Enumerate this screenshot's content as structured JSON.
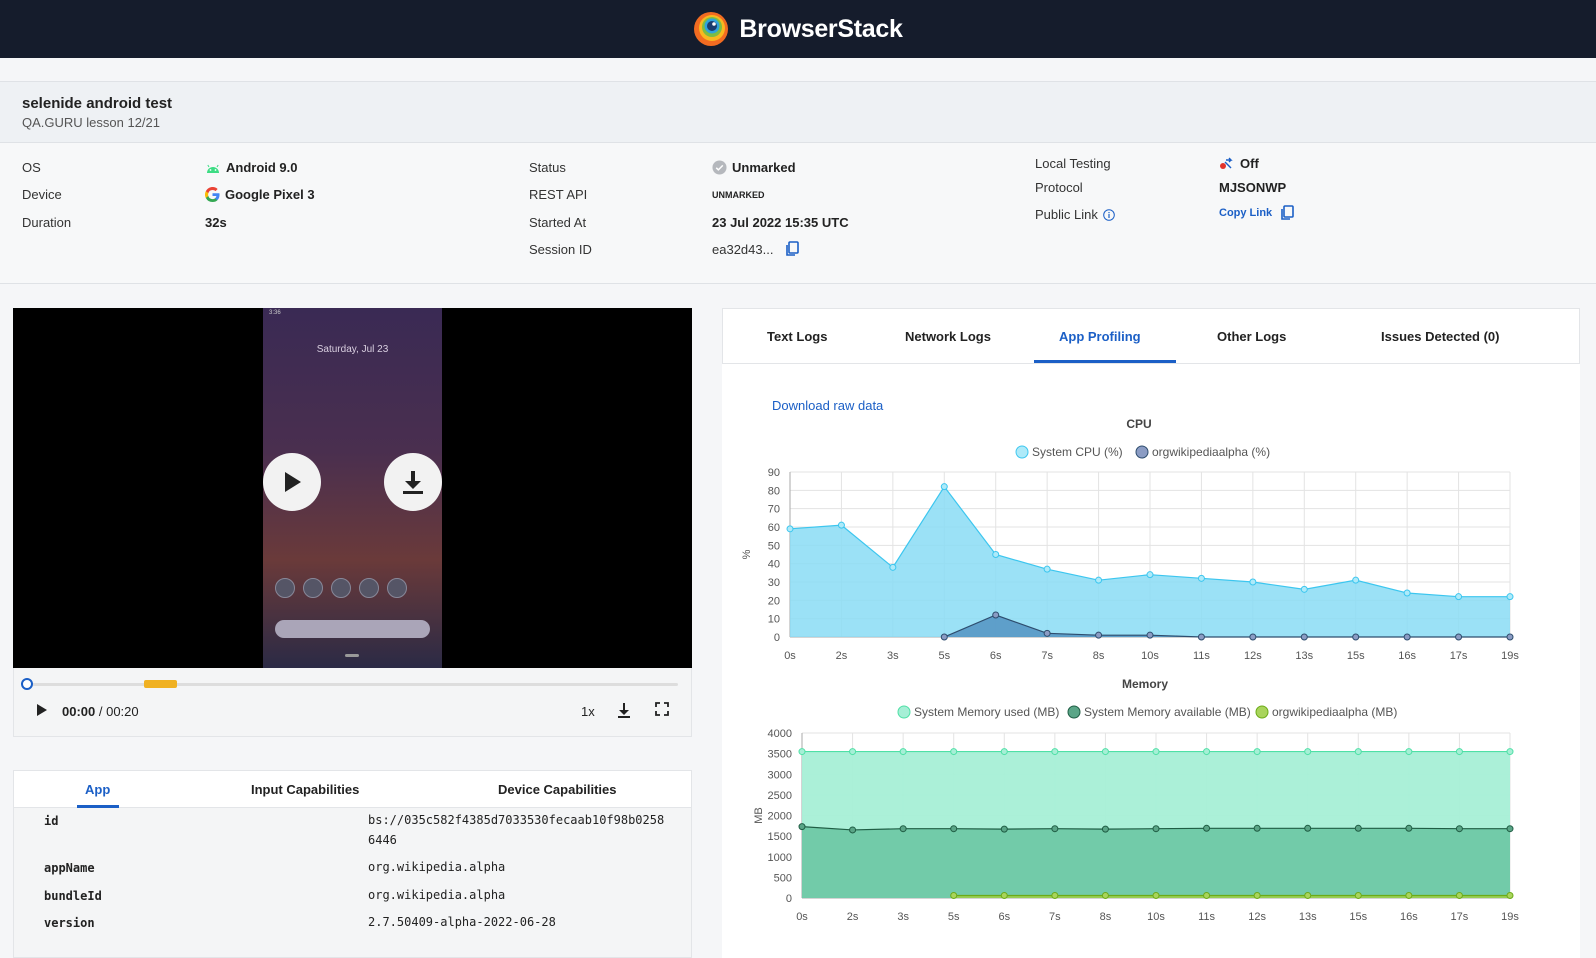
{
  "brand": {
    "name": "BrowserStack"
  },
  "build": {
    "title": "selenide android test",
    "subtitle": "QA.GURU lesson 12/21"
  },
  "details": {
    "os_label": "OS",
    "os_value": "Android 9.0",
    "device_label": "Device",
    "device_value": "Google Pixel 3",
    "duration_label": "Duration",
    "duration_value": "32s",
    "status_label": "Status",
    "status_value": "Unmarked",
    "rest_label": "REST API",
    "rest_value": "UNMARKED",
    "started_label": "Started At",
    "started_value": "23 Jul 2022 15:35 UTC",
    "session_label": "Session ID",
    "session_value": "ea32d43...",
    "local_label": "Local Testing",
    "local_value": "Off",
    "protocol_label": "Protocol",
    "protocol_value": "MJSONWP",
    "public_label": "Public Link",
    "public_value": "Copy Link"
  },
  "video": {
    "phone_date": "Saturday, Jul 23",
    "phone_time": "3:36",
    "current": "00:00",
    "total": "/ 00:20",
    "speed": "1x",
    "progress": 0,
    "buffered_from": 0.18,
    "buffered_to": 0.23
  },
  "left_tabs": [
    {
      "label": "App",
      "active": true
    },
    {
      "label": "Input Capabilities",
      "active": false
    },
    {
      "label": "Device Capabilities",
      "active": false
    }
  ],
  "caps": [
    {
      "key": "id",
      "value": "bs://035c582f4385d7033530fecaab10f98b02586446"
    },
    {
      "key": "appName",
      "value": "org.wikipedia.alpha"
    },
    {
      "key": "bundleId",
      "value": "org.wikipedia.alpha"
    },
    {
      "key": "version",
      "value": "2.7.50409-alpha-2022-06-28"
    }
  ],
  "right_tabs": [
    {
      "label": "Text Logs",
      "active": false
    },
    {
      "label": "Network Logs",
      "active": false
    },
    {
      "label": "App Profiling",
      "active": true
    },
    {
      "label": "Other Logs",
      "active": false
    },
    {
      "label": "Issues Detected (0)",
      "active": false
    }
  ],
  "download_raw": "Download raw data",
  "colors": {
    "accent": "#1b5fc6",
    "cpu_fill": "#8adcf5",
    "cpu_line": "#3cc6ef",
    "app_cpu": "#4f8fbf",
    "mem_used": "#a6efd6",
    "mem_avail": "#6cc7a4",
    "mem_app": "#9bcf4a"
  },
  "chart_data": [
    {
      "type": "area",
      "title": "CPU",
      "ylabel": "%",
      "ylim": [
        0,
        90
      ],
      "yticks": [
        0,
        10,
        20,
        30,
        40,
        50,
        60,
        70,
        80,
        90
      ],
      "x": [
        "0s",
        "2s",
        "3s",
        "5s",
        "6s",
        "7s",
        "8s",
        "10s",
        "11s",
        "12s",
        "13s",
        "15s",
        "16s",
        "17s",
        "19s"
      ],
      "series": [
        {
          "name": "System CPU (%)",
          "values": [
            59,
            61,
            38,
            82,
            45,
            37,
            31,
            34,
            32,
            30,
            26,
            31,
            24,
            22,
            22
          ]
        },
        {
          "name": "orgwikipediaalpha (%)",
          "values": [
            null,
            null,
            null,
            0,
            12,
            2,
            1,
            1,
            0,
            0,
            0,
            0,
            0,
            0,
            0
          ]
        }
      ],
      "legend": "top"
    },
    {
      "type": "area",
      "title": "Memory",
      "ylabel": "MB",
      "ylim": [
        0,
        4000
      ],
      "yticks": [
        0,
        500,
        1000,
        1500,
        2000,
        2500,
        3000,
        3500,
        4000
      ],
      "x": [
        "0s",
        "2s",
        "3s",
        "5s",
        "6s",
        "7s",
        "8s",
        "10s",
        "11s",
        "12s",
        "13s",
        "15s",
        "16s",
        "17s",
        "19s"
      ],
      "series": [
        {
          "name": "System Memory used (MB)",
          "values": [
            3550,
            3550,
            3550,
            3550,
            3550,
            3550,
            3550,
            3550,
            3550,
            3550,
            3550,
            3550,
            3550,
            3550,
            3550
          ]
        },
        {
          "name": "System Memory available (MB)",
          "values": [
            1730,
            1650,
            1680,
            1680,
            1670,
            1680,
            1670,
            1680,
            1690,
            1690,
            1690,
            1690,
            1690,
            1680,
            1680
          ]
        },
        {
          "name": "orgwikipediaalpha (MB)",
          "values": [
            null,
            null,
            null,
            60,
            60,
            60,
            60,
            60,
            60,
            60,
            60,
            60,
            60,
            60,
            60
          ]
        }
      ],
      "legend": "top"
    }
  ]
}
